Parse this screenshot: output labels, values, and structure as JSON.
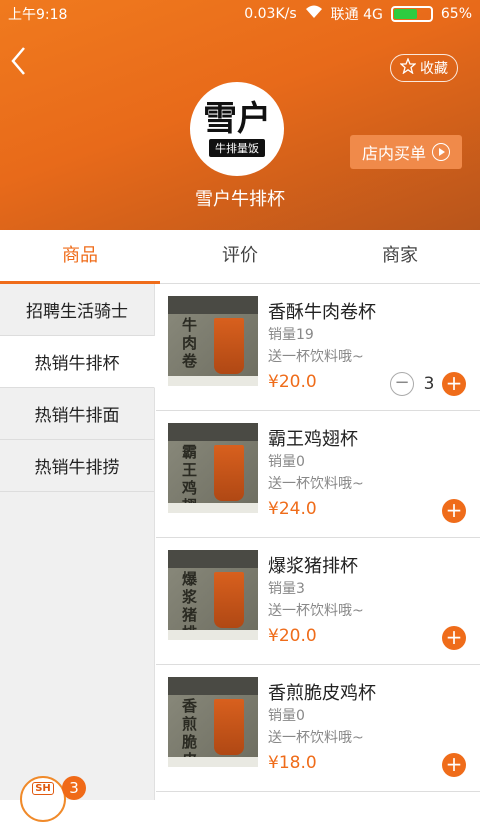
{
  "status_bar": {
    "time": "上午9:18",
    "net_speed": "0.03K/s",
    "carrier": "联通 4G",
    "battery": "65%",
    "battery_level": 0.65
  },
  "header": {
    "back_icon": "chevron-left-icon",
    "favorite_label": "收藏",
    "logo_text": "雪户",
    "logo_sub": "牛排量饭",
    "shop_name": "雪户牛排杯",
    "instore_label": "店内买单",
    "colors": {
      "accent": "#ef6c1a",
      "header_start": "#f07a1e",
      "header_end": "#b8551b"
    }
  },
  "tabs": [
    {
      "label": "商品",
      "active": true
    },
    {
      "label": "评价",
      "active": false
    },
    {
      "label": "商家",
      "active": false
    }
  ],
  "sidebar": {
    "items": [
      {
        "label": "招聘生活骑士",
        "active": false
      },
      {
        "label": "热销牛排杯",
        "active": true
      },
      {
        "label": "热销牛排面",
        "active": false
      },
      {
        "label": "热销牛排捞",
        "active": false
      }
    ]
  },
  "products": [
    {
      "name": "香酥牛肉卷杯",
      "sold": "销量19",
      "desc": "送一杯饮料哦~",
      "price": "¥20.0",
      "qty": "3",
      "thumb_text": "牛肉卷"
    },
    {
      "name": "霸王鸡翅杯",
      "sold": "销量0",
      "desc": "送一杯饮料哦~",
      "price": "¥24.0",
      "qty": "",
      "thumb_text": "霸王鸡翅"
    },
    {
      "name": "爆浆猪排杯",
      "sold": "销量3",
      "desc": "送一杯饮料哦~",
      "price": "¥20.0",
      "qty": "",
      "thumb_text": "爆浆猪排"
    },
    {
      "name": "香煎脆皮鸡杯",
      "sold": "销量0",
      "desc": "送一杯饮料哦~",
      "price": "¥18.0",
      "qty": "",
      "thumb_text": "香煎脆皮"
    }
  ],
  "cart": {
    "label": "SH",
    "count": "3"
  }
}
